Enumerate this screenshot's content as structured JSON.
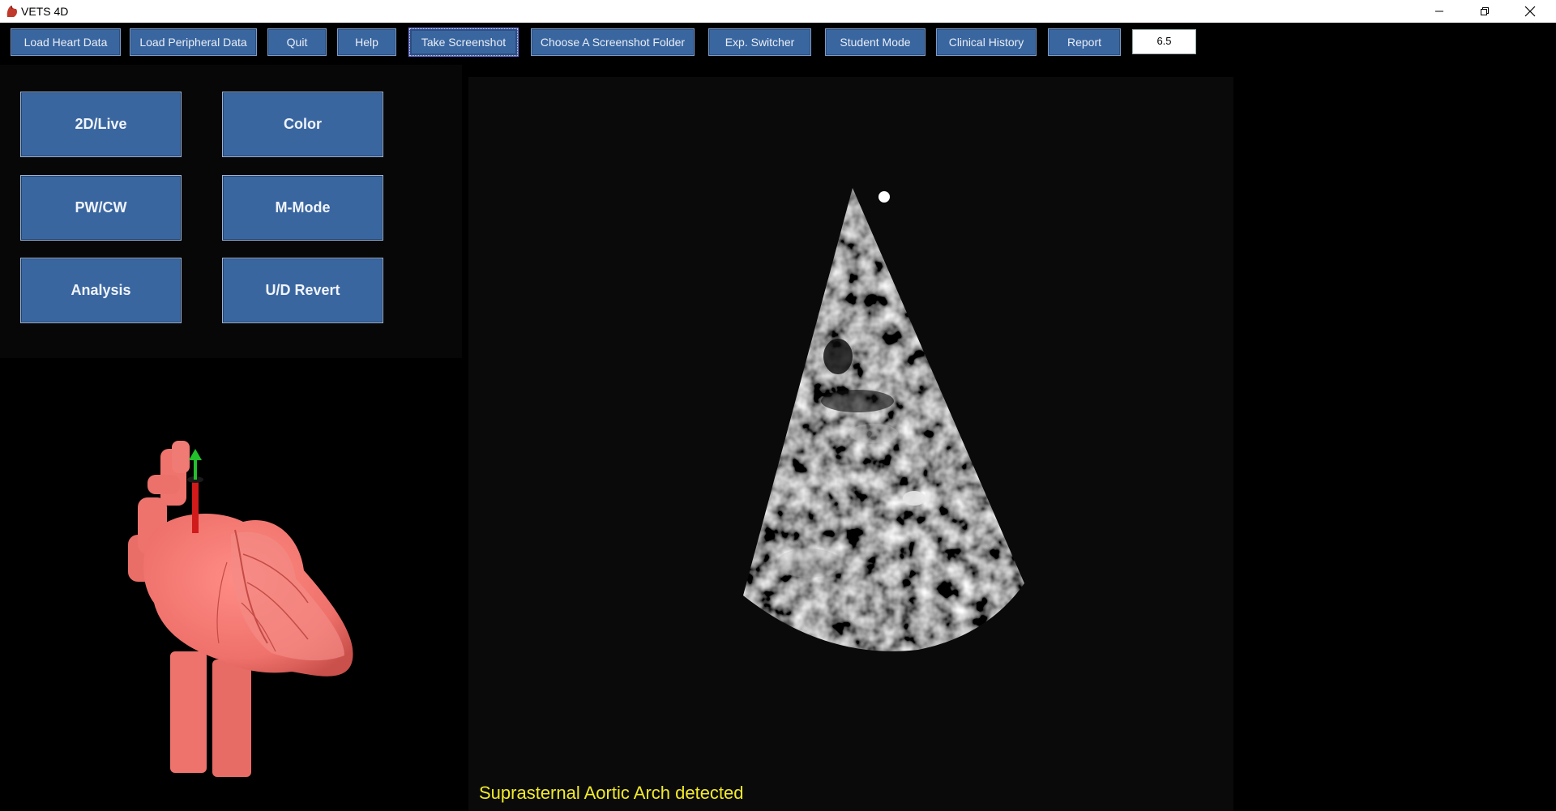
{
  "window": {
    "title": "VETS 4D"
  },
  "toolbar": {
    "buttons": [
      {
        "id": "load-heart-data",
        "label": "Load Heart Data"
      },
      {
        "id": "load-peripheral-data",
        "label": "Load Peripheral Data"
      },
      {
        "id": "quit",
        "label": "Quit"
      },
      {
        "id": "help",
        "label": "Help"
      },
      {
        "id": "take-screenshot",
        "label": "Take Screenshot"
      },
      {
        "id": "choose-screenshot-folder",
        "label": "Choose A Screenshot Folder"
      },
      {
        "id": "exp-switcher",
        "label": "Exp. Switcher"
      },
      {
        "id": "student-mode",
        "label": "Student Mode"
      },
      {
        "id": "clinical-history",
        "label": "Clinical History"
      },
      {
        "id": "report",
        "label": "Report"
      }
    ],
    "value": "6.5"
  },
  "modes": {
    "live": "2D/Live",
    "color": "Color",
    "pwcw": "PW/CW",
    "mmode": "M-Mode",
    "analysis": "Analysis",
    "ud_revert": "U/D Revert"
  },
  "status": {
    "message": "Suprasternal Aortic Arch detected"
  },
  "colors": {
    "button_bg": "#3a66a0",
    "status_text": "#f2ea2a",
    "heart": "#f07a74"
  },
  "icons": [
    "app-icon",
    "minimize-icon",
    "restore-icon",
    "close-icon"
  ]
}
